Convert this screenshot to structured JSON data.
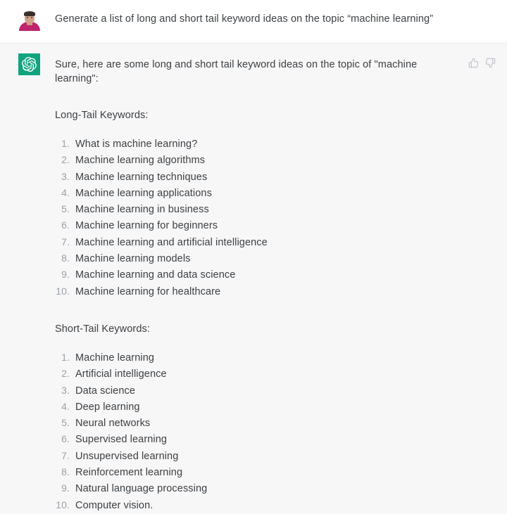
{
  "conversation": {
    "user_message": {
      "author": "user",
      "avatar_alt": "user-avatar-photo",
      "text": "Generate a list of long and short tail keyword ideas on the topic “machine learning”"
    },
    "assistant_message": {
      "author": "assistant",
      "avatar_alt": "chatgpt-logo",
      "text": "Sure, here are some long and short tail keyword ideas on the topic of \"machine learning\":",
      "feedback": {
        "thumbs_up_label": "thumbs-up",
        "thumbs_down_label": "thumbs-down"
      },
      "sections": [
        {
          "heading": "Long-Tail Keywords:",
          "items": [
            "What is machine learning?",
            "Machine learning algorithms",
            "Machine learning techniques",
            "Machine learning applications",
            "Machine learning in business",
            "Machine learning for beginners",
            "Machine learning and artificial intelligence",
            "Machine learning models",
            "Machine learning and data science",
            "Machine learning for healthcare"
          ]
        },
        {
          "heading": "Short-Tail Keywords:",
          "items": [
            "Machine learning",
            "Artificial intelligence",
            "Data science",
            "Deep learning",
            "Neural networks",
            "Supervised learning",
            "Unsupervised learning",
            "Reinforcement learning",
            "Natural language processing",
            "Computer vision."
          ]
        }
      ]
    }
  },
  "theme": {
    "user_bg": "#ffffff",
    "assistant_bg": "#f7f7f8",
    "text_color": "#3c4043",
    "number_color": "#9aa0a6",
    "brand_green": "#10a37f",
    "icon_gray": "#c5c5d2",
    "divider": "#e7e7e8"
  }
}
